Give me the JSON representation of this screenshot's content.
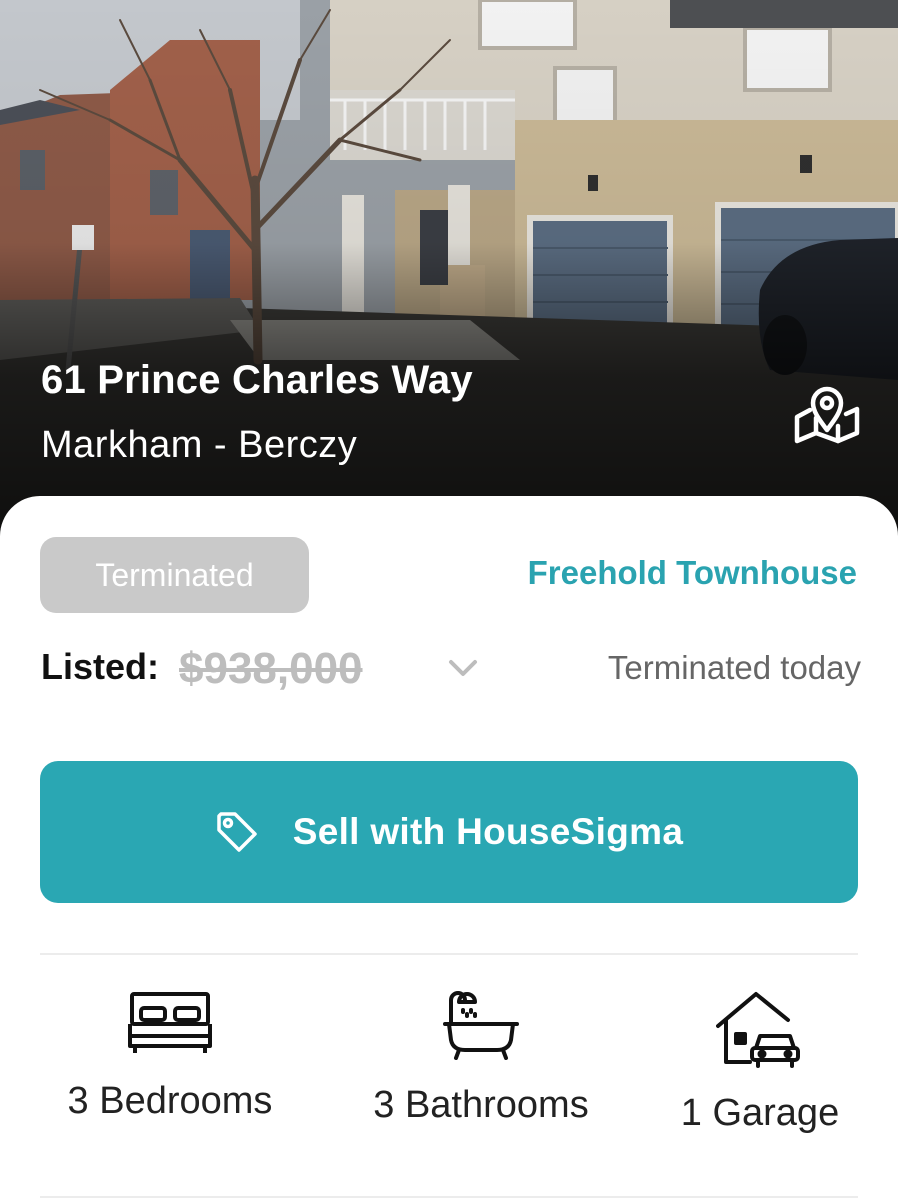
{
  "listing": {
    "address": "61 Prince Charles Way",
    "area": "Markham - Berczy",
    "status": "Terminated",
    "property_type": "Freehold Townhouse",
    "listed_label": "Listed:",
    "listed_price": "$938,000",
    "terminated_when": "Terminated today"
  },
  "actions": {
    "sell_label": "Sell with HouseSigma"
  },
  "features": [
    {
      "label": "3 Bedrooms",
      "icon": "bed-icon"
    },
    {
      "label": "3 Bathrooms",
      "icon": "bathtub-icon"
    },
    {
      "label": "1 Garage",
      "icon": "garage-icon"
    }
  ],
  "colors": {
    "accent": "#2aa7b3",
    "status_badge": "#c9c9c9",
    "price_strikethrough": "#bdbdbd"
  },
  "icons": {
    "map": "map-pin-icon",
    "tag": "tag-icon",
    "chevron": "chevron-down-icon"
  }
}
